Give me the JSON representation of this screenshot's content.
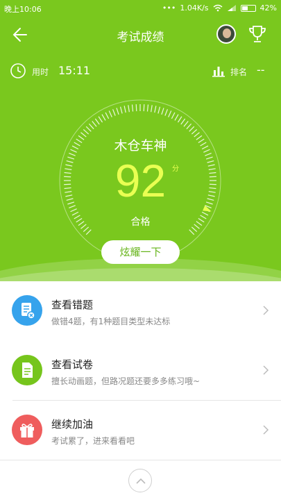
{
  "status_bar": {
    "time": "晚上10:06",
    "net_speed": "1.04K/s",
    "battery": "42%"
  },
  "nav": {
    "title": "考试成绩"
  },
  "stats": {
    "time_label": "用时",
    "time_value": "15:11",
    "rank_label": "排名",
    "rank_value": "--"
  },
  "result": {
    "title": "木仓车神",
    "score": "92",
    "unit": "分",
    "status": "合格",
    "share_label": "炫耀一下",
    "score_fraction": 0.92
  },
  "items": [
    {
      "title": "查看错题",
      "subtitle": "做错4题，有1种题目类型未达标",
      "color": "#36a3ec",
      "icon": "wrong-questions-icon"
    },
    {
      "title": "查看试卷",
      "subtitle": "擅长动画题，但路况题还要多多练习哦~",
      "color": "#76c51c",
      "icon": "paper-icon"
    },
    {
      "title": "继续加油",
      "subtitle": "考试累了，进来看看吧",
      "color": "#ef5d5d",
      "icon": "gift-icon"
    }
  ],
  "colors": {
    "header_green": "#7ac81e",
    "score_yellow": "#e9ff52"
  }
}
